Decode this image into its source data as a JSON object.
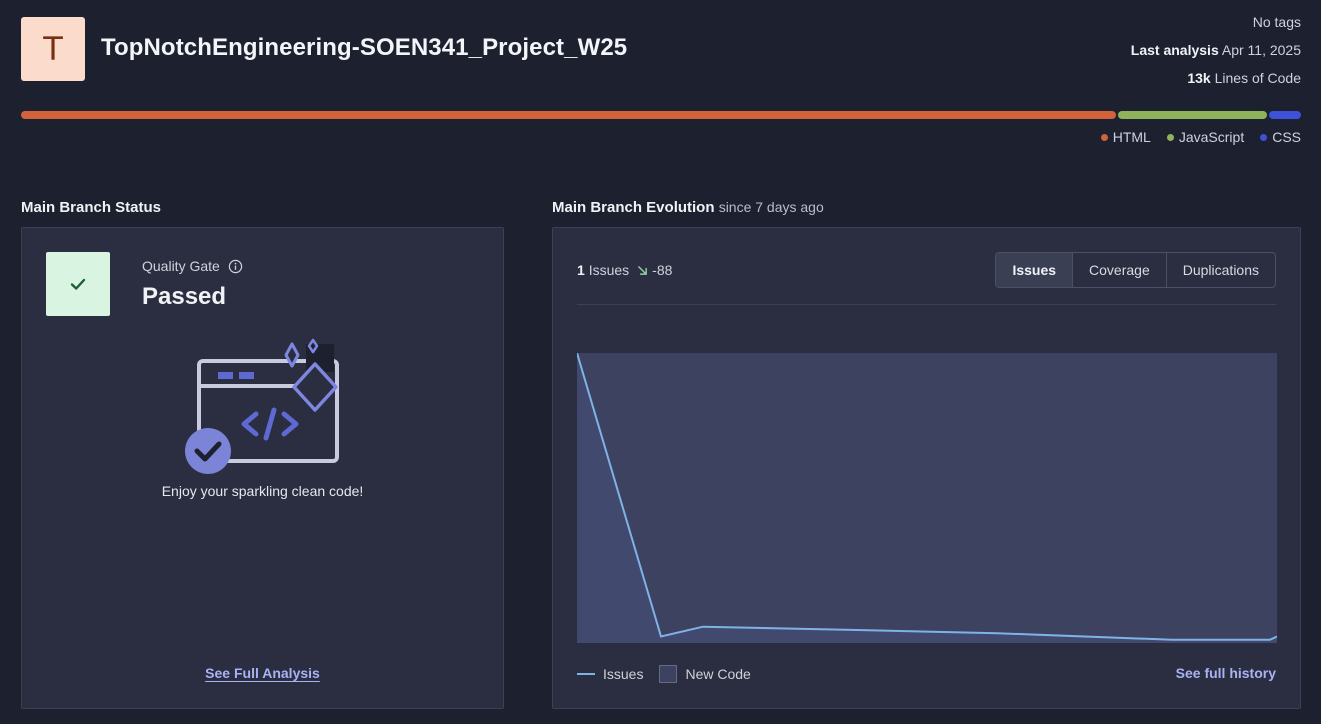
{
  "project": {
    "avatar_letter": "T",
    "name": "TopNotchEngineering-SOEN341_Project_W25",
    "tags": "No tags",
    "last_analysis_label": "Last analysis",
    "last_analysis_date": "Apr 11, 2025",
    "loc_value": "13k",
    "loc_label": "Lines of Code"
  },
  "languages": [
    {
      "name": "HTML",
      "color": "#d1623a",
      "fraction": 0.858
    },
    {
      "name": "JavaScript",
      "color": "#8fb35b",
      "fraction": 0.117
    },
    {
      "name": "CSS",
      "color": "#3c52d9",
      "fraction": 0.025
    }
  ],
  "status": {
    "section_title": "Main Branch Status",
    "quality_gate_label": "Quality Gate",
    "quality_gate_value": "Passed",
    "message": "Enjoy your sparkling clean code!",
    "full_analysis_link": "See Full Analysis"
  },
  "evolution": {
    "section_title": "Main Branch Evolution",
    "section_sub": "since 7 days ago",
    "issues_count": "1",
    "issues_word": "Issues",
    "issues_delta": "-88",
    "tabs": [
      "Issues",
      "Coverage",
      "Duplications"
    ],
    "active_tab": "Issues",
    "legend_issues": "Issues",
    "legend_new_code": "New Code",
    "full_history_link": "See full history"
  },
  "chart_data": {
    "type": "line",
    "series": [
      {
        "name": "Issues",
        "values": [
          89,
          2,
          5,
          4,
          3,
          1,
          1,
          2
        ]
      }
    ],
    "x": [
      0,
      0.12,
      0.18,
      0.4,
      0.6,
      0.85,
      0.99,
      1.0
    ],
    "ylim": [
      0,
      89
    ],
    "new_code_shaded": true,
    "line_color": "#7fb3e6",
    "area_color": "#3d4260"
  }
}
